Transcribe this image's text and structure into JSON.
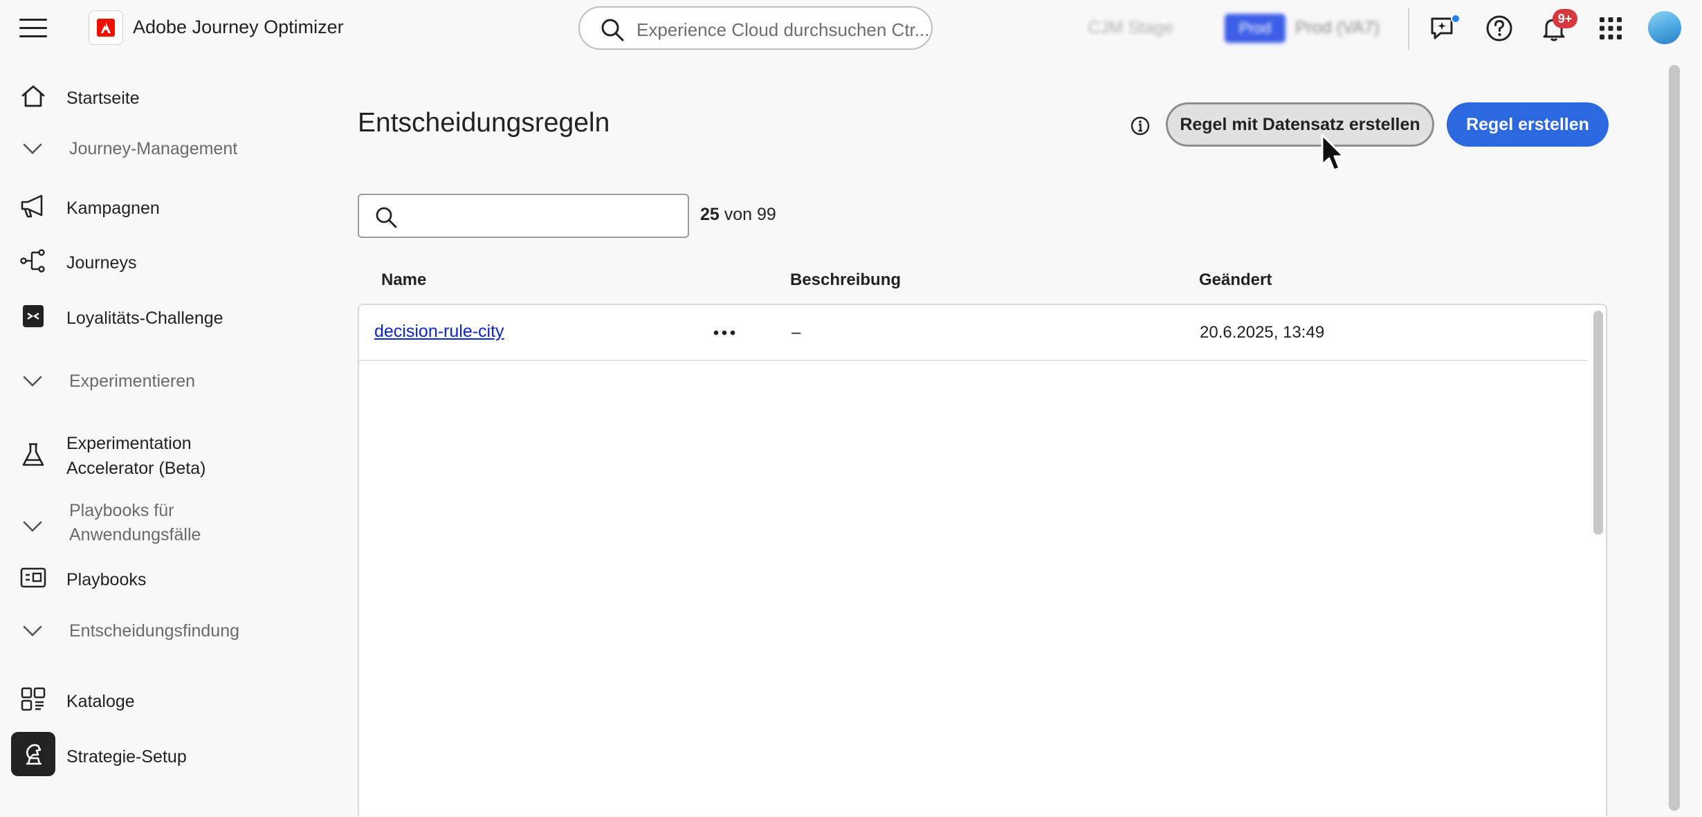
{
  "header": {
    "app_title": "Adobe Journey Optimizer",
    "search_placeholder": "Experience Cloud durchsuchen Ctr...",
    "org_name": "CJM Stage",
    "env_badge": "Prod",
    "env_name": "Prod (VA7)",
    "notification_count": "9+",
    "icons": [
      "menu-icon",
      "adobe-logo-icon",
      "search-icon",
      "chat-icon",
      "help-icon",
      "bell-icon",
      "apps-grid-icon",
      "avatar"
    ]
  },
  "sidebar": {
    "items": [
      {
        "label": "Startseite",
        "icon": "home-icon"
      },
      {
        "label": "Journey-Management",
        "type": "section"
      },
      {
        "label": "Kampagnen",
        "icon": "megaphone-icon"
      },
      {
        "label": "Journeys",
        "icon": "journey-icon"
      },
      {
        "label": "Loyalitäts-Challenge",
        "icon": "challenge-icon"
      },
      {
        "label": "Experimentieren",
        "type": "section"
      },
      {
        "label": "Experimentation",
        "label2": "Accelerator (Beta)",
        "icon": "flask-icon"
      },
      {
        "label": "Playbooks für",
        "label2": "Anwendungsfälle",
        "type": "section"
      },
      {
        "label": "Playbooks",
        "icon": "playbook-icon"
      },
      {
        "label": "Entscheidungsfindung",
        "type": "section"
      },
      {
        "label": "Kataloge",
        "icon": "catalog-icon"
      },
      {
        "label": "Strategie-Setup",
        "icon": "strategy-icon",
        "active": true
      }
    ]
  },
  "main": {
    "title": "Entscheidungsregeln",
    "btn_dataset": "Regel mit Datensatz erstellen",
    "btn_create": "Regel erstellen",
    "search_value": "",
    "count_shown": "25",
    "count_text": "von 99",
    "columns": [
      "Name",
      "Beschreibung",
      "Geändert"
    ],
    "rows": [
      {
        "name": "decision-rule-city",
        "description": "–",
        "modified": "20.6.2025, 13:49"
      }
    ]
  },
  "colors": {
    "primary": "#2c68e0",
    "link": "#0a26cc",
    "badge": "#d7373f",
    "adobe_red": "#eb1000"
  }
}
